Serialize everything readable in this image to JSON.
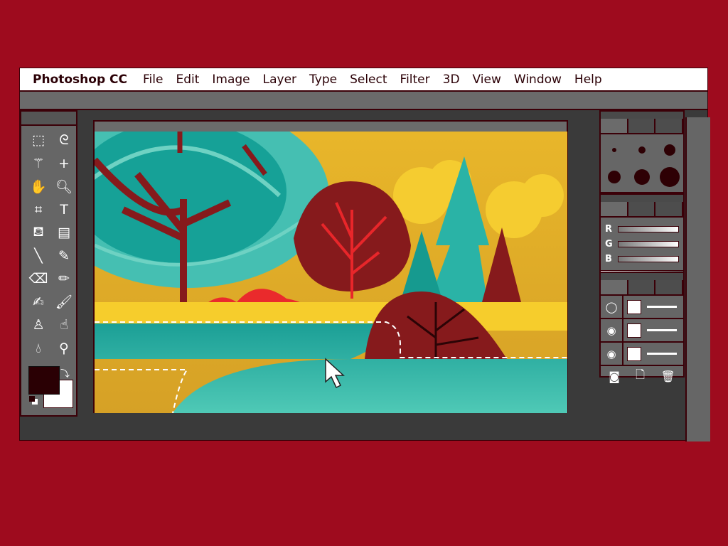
{
  "menubar": {
    "app": "Photoshop CC",
    "items": [
      "File",
      "Edit",
      "Image",
      "Layer",
      "Type",
      "Select",
      "Filter",
      "3D",
      "View",
      "Window",
      "Help"
    ]
  },
  "tools": [
    {
      "name": "rectangular-marquee",
      "glyph": "⬚"
    },
    {
      "name": "lasso",
      "glyph": "ᘓ"
    },
    {
      "name": "magic-wand",
      "glyph": "⚚"
    },
    {
      "name": "move",
      "glyph": "+"
    },
    {
      "name": "hand",
      "glyph": "✋"
    },
    {
      "name": "zoom",
      "glyph": "🔍︎"
    },
    {
      "name": "crop",
      "glyph": "⌗"
    },
    {
      "name": "type",
      "glyph": "T"
    },
    {
      "name": "paint-bucket",
      "glyph": "⛾"
    },
    {
      "name": "gradient",
      "glyph": "▤"
    },
    {
      "name": "line",
      "glyph": "╲"
    },
    {
      "name": "eyedropper",
      "glyph": "✎"
    },
    {
      "name": "eraser",
      "glyph": "⌫"
    },
    {
      "name": "pencil",
      "glyph": "✏"
    },
    {
      "name": "healing-brush",
      "glyph": "✍"
    },
    {
      "name": "brush",
      "glyph": "🖌︎"
    },
    {
      "name": "clone-stamp",
      "glyph": "♙"
    },
    {
      "name": "smudge",
      "glyph": "☝"
    },
    {
      "name": "blur",
      "glyph": "💧︎"
    },
    {
      "name": "dodge",
      "glyph": "⚲"
    }
  ],
  "colors": {
    "foreground": "#2a0004",
    "background": "#ffffff",
    "accent": "#9e0b1e"
  },
  "color_panel": {
    "channels": [
      "R",
      "G",
      "B"
    ]
  },
  "layers": [
    {
      "visible": true,
      "eye": "eye-outline"
    },
    {
      "visible": true
    },
    {
      "visible": true
    }
  ],
  "layer_footer": [
    "mask-icon",
    "new-layer-icon",
    "trash-icon"
  ]
}
